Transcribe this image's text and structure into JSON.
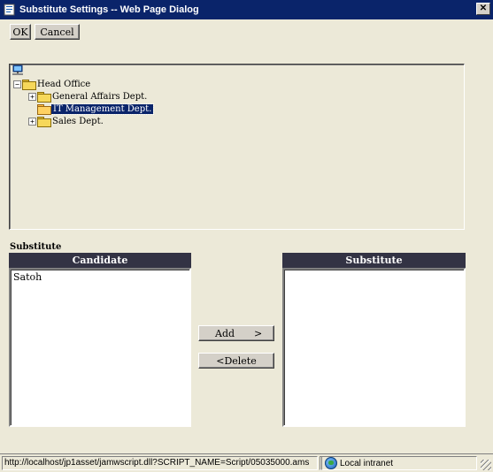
{
  "window": {
    "title": "Substitute Settings -- Web Page Dialog",
    "close_glyph": "✕"
  },
  "toolbar": {
    "ok_label": "OK",
    "cancel_label": "Cancel"
  },
  "tree": {
    "root_icon": "network-icon",
    "nodes": [
      {
        "label": "Head Office",
        "expander": "−"
      },
      {
        "label": "General Affairs Dept.",
        "expander": "+"
      },
      {
        "label": "IT Management Dept.",
        "expander": "",
        "selected": true
      },
      {
        "label": "Sales Dept.",
        "expander": "+"
      }
    ]
  },
  "substitute": {
    "section_label": "Substitute",
    "candidate_header": "Candidate",
    "substitute_header": "Substitute",
    "candidates": [
      "Satoh"
    ],
    "substitutes": [],
    "add_label": "Add",
    "add_arrow": ">",
    "delete_label": "<Delete"
  },
  "statusbar": {
    "url": "http://localhost/jp1asset/jamwscript.dll?SCRIPT_NAME=Script/05035000.ams",
    "zone": "Local intranet",
    "zone_icon": "globe-icon"
  },
  "colors": {
    "titlebar": "#0a246a",
    "list_header": "#333344",
    "selection": "#0a246a",
    "dialog_bg": "#ece9d8"
  }
}
